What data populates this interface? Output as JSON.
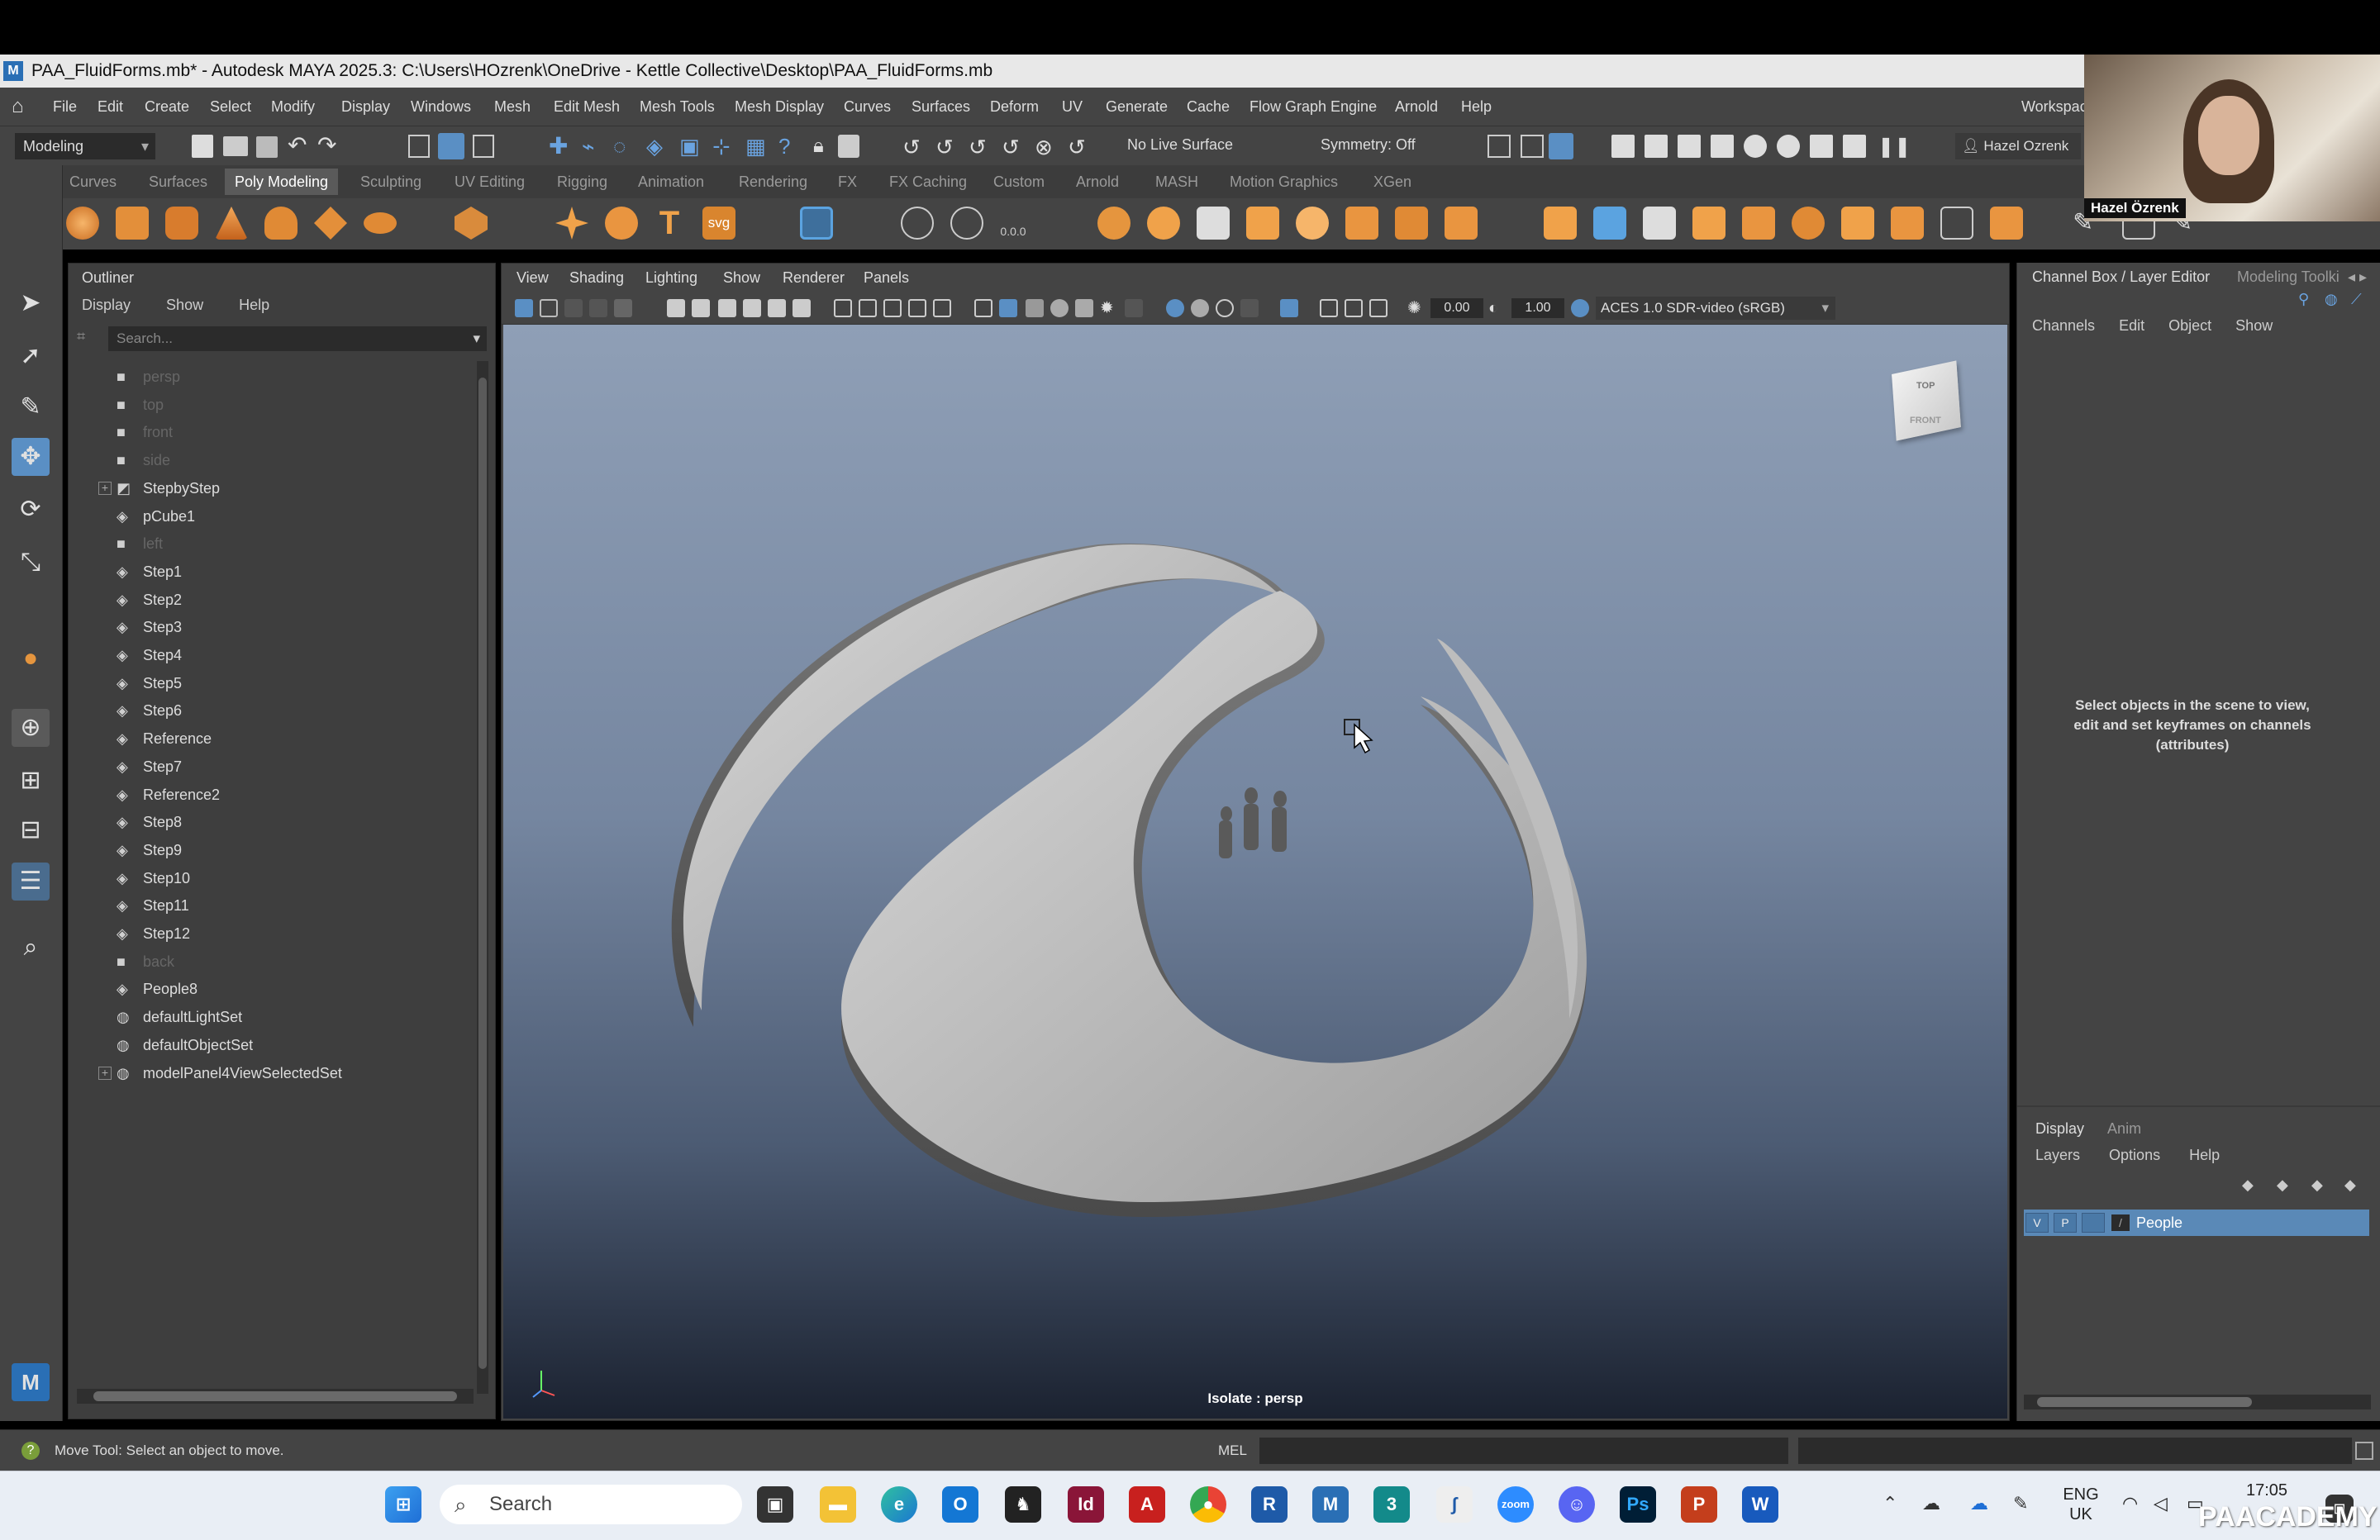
{
  "window": {
    "title": "PAA_FluidForms.mb* - Autodesk MAYA 2025.3: C:\\Users\\HOzrenk\\OneDrive - Kettle Collective\\Desktop\\PAA_FluidForms.mb",
    "app_icon": "M"
  },
  "menubar": {
    "items": [
      "File",
      "Edit",
      "Create",
      "Select",
      "Modify",
      "Display",
      "Windows",
      "Mesh",
      "Edit Mesh",
      "Mesh Tools",
      "Mesh Display",
      "Curves",
      "Surfaces",
      "Deform",
      "UV",
      "Generate",
      "Cache",
      "Flow Graph Engine",
      "Arnold",
      "Help"
    ],
    "workspace": "Workspac"
  },
  "statusline": {
    "mode_select": "Modeling",
    "live_surface": "No Live Surface",
    "symmetry": "Symmetry: Off",
    "user": "Hazel Ozrenk"
  },
  "shelf": {
    "tabs": [
      "Curves",
      "Surfaces",
      "Poly Modeling",
      "Sculpting",
      "UV Editing",
      "Rigging",
      "Animation",
      "Rendering",
      "FX",
      "FX Caching",
      "Custom",
      "Arnold",
      "MASH",
      "Motion Graphics",
      "XGen"
    ],
    "active_tab": "Poly Modeling",
    "svg_label": "svg",
    "num_label": "0.0.0"
  },
  "outliner": {
    "title": "Outliner",
    "menu": [
      "Display",
      "Show",
      "Help"
    ],
    "search_placeholder": "Search...",
    "rows": [
      {
        "label": "persp",
        "icon": "camera-icon",
        "dim": true
      },
      {
        "label": "top",
        "icon": "camera-icon",
        "dim": true
      },
      {
        "label": "front",
        "icon": "camera-icon",
        "dim": true
      },
      {
        "label": "side",
        "icon": "camera-icon",
        "dim": true
      },
      {
        "label": "StepbyStep",
        "icon": "group-icon",
        "expand": true
      },
      {
        "label": "pCube1",
        "icon": "mesh-icon"
      },
      {
        "label": "left",
        "icon": "camera-icon",
        "dim": true
      },
      {
        "label": "Step1",
        "icon": "mesh-icon"
      },
      {
        "label": "Step2",
        "icon": "mesh-icon"
      },
      {
        "label": "Step3",
        "icon": "mesh-icon"
      },
      {
        "label": "Step4",
        "icon": "mesh-icon"
      },
      {
        "label": "Step5",
        "icon": "mesh-icon"
      },
      {
        "label": "Step6",
        "icon": "mesh-icon"
      },
      {
        "label": "Reference",
        "icon": "mesh-icon"
      },
      {
        "label": "Step7",
        "icon": "mesh-icon"
      },
      {
        "label": "Reference2",
        "icon": "mesh-icon"
      },
      {
        "label": "Step8",
        "icon": "mesh-icon"
      },
      {
        "label": "Step9",
        "icon": "mesh-icon"
      },
      {
        "label": "Step10",
        "icon": "mesh-icon"
      },
      {
        "label": "Step11",
        "icon": "mesh-icon"
      },
      {
        "label": "Step12",
        "icon": "mesh-icon"
      },
      {
        "label": "back",
        "icon": "camera-icon",
        "dim": true
      },
      {
        "label": "People8",
        "icon": "mesh-icon"
      },
      {
        "label": "defaultLightSet",
        "icon": "set-icon"
      },
      {
        "label": "defaultObjectSet",
        "icon": "set-icon"
      },
      {
        "label": "modelPanel4ViewSelectedSet",
        "icon": "set-icon",
        "expand": true
      }
    ]
  },
  "viewport": {
    "menu": [
      "View",
      "Shading",
      "Lighting",
      "Show",
      "Renderer",
      "Panels"
    ],
    "exposure": "0.00",
    "gamma": "1.00",
    "color_space": "ACES 1.0 SDR-video (sRGB)",
    "status": "Isolate : persp",
    "viewcube_top": "TOP",
    "viewcube_front": "FRONT"
  },
  "channelbox": {
    "title": "Channel Box / Layer Editor",
    "side_tab": "Modeling Toolki",
    "menu": [
      "Channels",
      "Edit",
      "Object",
      "Show"
    ],
    "message": "Select objects in the scene to view, edit and set keyframes on channels (attributes)",
    "layer_tabs": [
      "Display",
      "Anim"
    ],
    "layer_menu": [
      "Layers",
      "Options",
      "Help"
    ],
    "layer": {
      "v": "V",
      "p": "P",
      "name": "People"
    }
  },
  "commandline": {
    "help": "Move Tool: Select an object to move.",
    "lang": "MEL"
  },
  "toolbox": {
    "maya_badge": "M"
  },
  "taskbar": {
    "search": "Search",
    "lang_line1": "ENG",
    "lang_line2": "UK",
    "time": "17:05",
    "watermark": "PAACADEMY"
  },
  "webcam": {
    "name": "Hazel Özrenk"
  }
}
